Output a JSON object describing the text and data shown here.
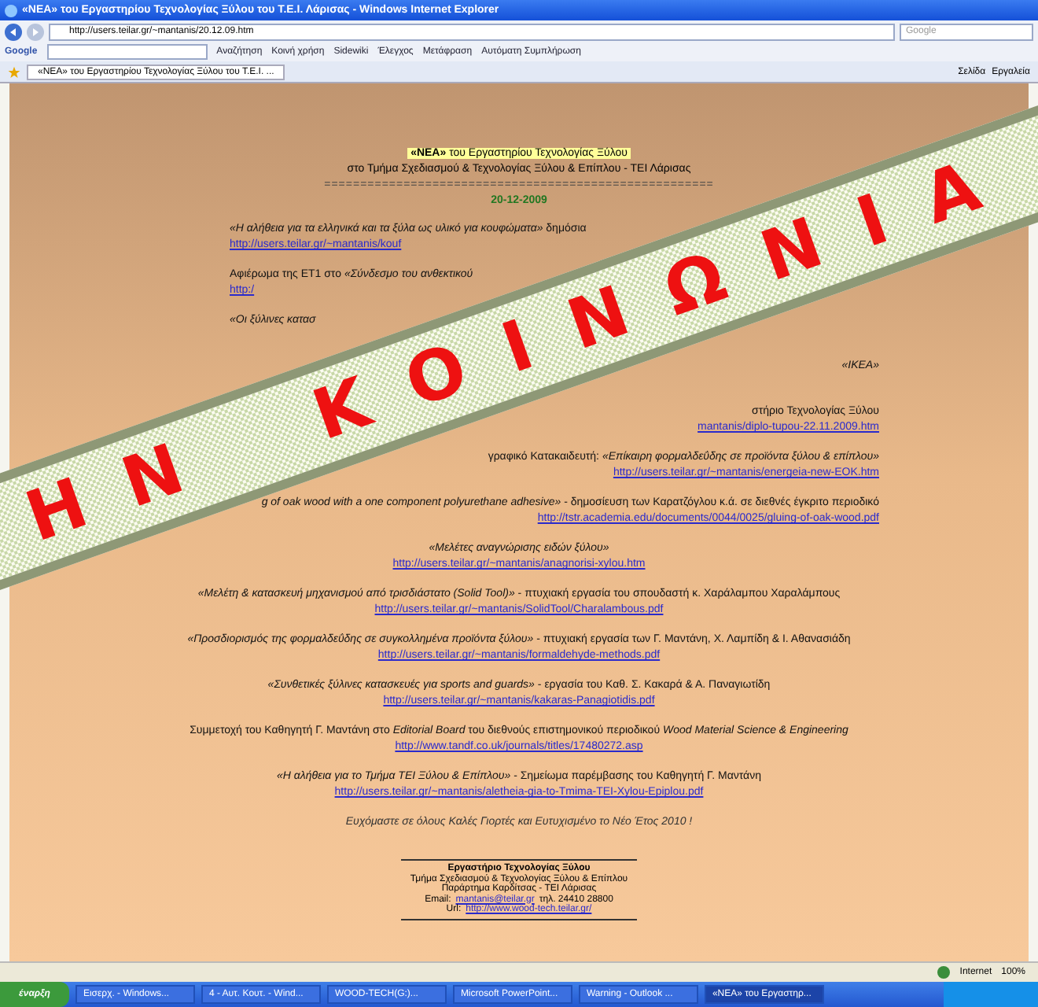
{
  "window": {
    "title": "«ΝΕΑ» του Εργαστηρίου Τεχνολογίας Ξύλου του Τ.Ε.Ι. Λάρισας - Windows Internet Explorer"
  },
  "address_bar": {
    "url": "http://users.teilar.gr/~mantanis/20.12.09.htm",
    "search_placeholder": "Google"
  },
  "google_toolbar": {
    "logo": "Google",
    "buttons": [
      "Αναζήτηση",
      "Κοινή χρήση",
      "Sidewiki",
      "Έλεγχος",
      "Μετάφραση",
      "Αυτόματη Συμπλήρωση"
    ]
  },
  "tab": {
    "title": "«ΝΕΑ» του Εργαστηρίου Τεχνολογίας Ξύλου του Τ.Ε.Ι. ...",
    "selected": true
  },
  "command_bar": [
    "Σελίδα",
    "Εργαλεία"
  ],
  "page": {
    "title": "**«ΝΕΑ»** του Εργαστηρίου Τεχνολογίας Ξύλου",
    "subtitle": "στο Τμήμα Σχεδιασμού & Τεχνολογίας Ξύλου & Επίπλου - ΤΕΙ Λάρισας",
    "separator": "======================================================",
    "date": "20-12-2009",
    "items": [
      {
        "kind": "left",
        "text": "*«Η αλήθεια για τα ελληνικά και τα ξύλα ως υλικό για κουφώματα»* δημόσια",
        "link": "http://users.teilar.gr/~mantanis/kouf"
      },
      {
        "kind": "left",
        "text": "Αφιέρωμα της ΕΤ1 στο *«Σύνδεσμο του ανθεκτικού*",
        "link": "http:/"
      },
      {
        "kind": "left",
        "text": "*«Οι ξύλινες κατασ*"
      },
      {
        "kind": "right",
        "text": "*«ΙΚΕΑ»*"
      },
      {
        "kind": "right",
        "text": "στήριο Τεχνολογίας Ξύλου",
        "link": "mantanis/diplo-tupou-22.11.2009.htm"
      },
      {
        "kind": "right",
        "text": "γραφικό Κατακαιδευτή: *«Επίκαιρη φορμαλδεΰδης σε προϊόντα ξύλου & επίπλου»*",
        "link": "http://users.teilar.gr/~mantanis/energeia-new-EOK.htm"
      },
      {
        "kind": "right",
        "text": "*g of oak wood with a one component polyurethane adhesive»* - δημοσίευση των Καρατζόγλου κ.ά. σε διεθνές έγκριτο περιοδικό",
        "link": "http://tstr.academia.edu/documents/0044/0025/gluing-of-oak-wood.pdf"
      },
      {
        "kind": "center",
        "text": "*«Μελέτες αναγνώρισης ειδών ξύλου»*",
        "link": "http://users.teilar.gr/~mantanis/anagnorisi-xylou.htm"
      },
      {
        "kind": "center",
        "text": "*«Μελέτη & κατασκευή μηχανισμού από τρισδιάστατο (Solid Tool)»* - πτυχιακή εργασία του σπουδαστή κ. Χαράλαμπου Χαραλάμπους",
        "link": "http://users.teilar.gr/~mantanis/SolidTool/Charalambous.pdf"
      },
      {
        "kind": "center",
        "text": "*«Προσδιορισμός της φορμαλδεΰδης σε συγκολλημένα προϊόντα ξύλου»* - πτυχιακή εργασία των Γ. Μαντάνη, Χ. Λαμπίδη & Ι. Αθανασιάδη",
        "link": "http://users.teilar.gr/~mantanis/formaldehyde-methods.pdf"
      },
      {
        "kind": "center",
        "text": "*«Συνθετικές ξύλινες κατασκευές για sports and guards»* - εργασία του Καθ. Σ. Κακαρά & Α. Παναγιωτίδη",
        "link": "http://users.teilar.gr/~mantanis/kakaras-Panagiotidis.pdf"
      },
      {
        "kind": "center",
        "text": "Συμμετοχή του Καθηγητή Γ. Μαντάνη στο *Editorial Board* του διεθνούς επιστημονικού περιοδικού *Wood Material Science & Engineering*",
        "link": "http://www.tandf.co.uk/journals/titles/17480272.asp"
      },
      {
        "kind": "center",
        "text": "*«Η αλήθεια για το Τμήμα ΤΕΙ Ξύλου & Επίπλου»* - Σημείωμα παρέμβασης του Καθηγητή Γ. Μαντάνη",
        "link": "http://users.teilar.gr/~mantanis/aletheia-gia-to-Tmima-TEI-Xylou-Epiplou.pdf"
      }
    ],
    "greeting": "Ευχόμαστε σε όλους *Καλές Γιορτές και Ευτυχισμένο το Νέο Έτος 2010 !*",
    "footer": [
      {
        "text": "Εργαστήριο Τεχνολογίας Ξύλου"
      },
      {
        "text": "Τμήμα Σχεδιασμού & Τεχνολογίας Ξύλου & Επίπλου"
      },
      {
        "text": "Παράρτημα Καρδίτσας - ΤΕΙ Λάρισας"
      },
      {
        "text": "Email:",
        "link": "mantanis@teilar.gr",
        "after": "τηλ. 24410 28800"
      },
      {
        "text": "Url:",
        "link": "http://www.wood-tech.teilar.gr/"
      }
    ]
  },
  "banner": {
    "text": "ΗΝ ΚΟΙΝΩΝΙΑ"
  },
  "status_bar": {
    "zone": "Internet",
    "zoom": "100%"
  },
  "taskbar": {
    "start": "έναρξη",
    "tasks": [
      {
        "label": "Εισερχ. - Windows...",
        "selected": false
      },
      {
        "label": "4 - Αυτ. Κουτ. - Wind...",
        "selected": false
      },
      {
        "label": "WOOD-TECH(G:)...",
        "selected": false
      },
      {
        "label": "Microsoft PowerPoint...",
        "selected": false
      },
      {
        "label": "Warning - Outlook ...",
        "selected": false
      },
      {
        "label": "«ΝΕΑ» του Εργαστηρ...",
        "selected": true
      }
    ]
  }
}
